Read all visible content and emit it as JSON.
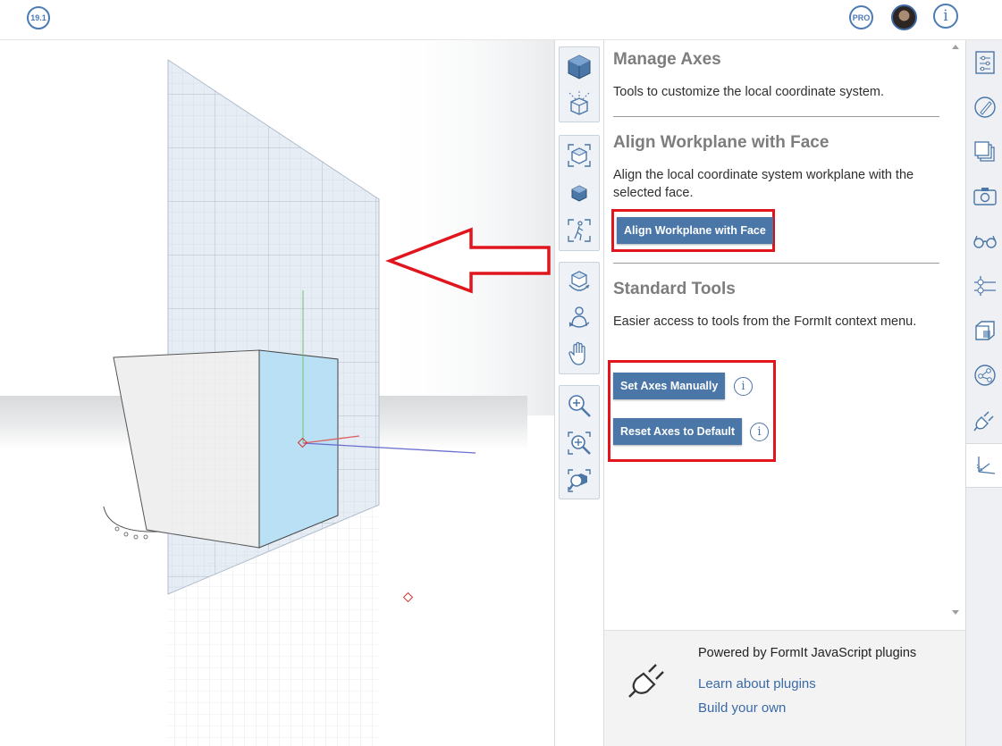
{
  "topbar": {
    "version_badge": "19.1",
    "pro_badge": "PRO",
    "info_glyph": "i"
  },
  "panel": {
    "sections": [
      {
        "title": "Manage Axes",
        "description": "Tools to customize the local coordinate system."
      },
      {
        "title": "Align Workplane with Face",
        "description": "Align the local coordinate system workplane with the selected face.",
        "button": "Align Workplane with Face"
      },
      {
        "title": "Standard Tools",
        "description": "Easier access to tools from the FormIt context menu.",
        "buttons": [
          "Set Axes Manually",
          "Reset Axes to Default"
        ]
      }
    ],
    "info_glyph": "i"
  },
  "footer": {
    "powered_by": "Powered by FormIt JavaScript plugins",
    "learn_link": "Learn about plugins",
    "build_link": "Build your own"
  },
  "colors": {
    "accent": "#4a76a8",
    "highlight_red": "#e0151e",
    "selected_face": "#b9e0f5"
  },
  "icons": {
    "toolstrip": [
      "view-cube-icon",
      "axes-view-icon",
      "perspective-view-icon",
      "shaded-view-icon",
      "walk-view-icon",
      "orbit-icon",
      "look-around-icon",
      "pan-hand-icon",
      "zoom-icon",
      "zoom-region-icon",
      "zoom-fit-icon"
    ],
    "sidebar": [
      "properties-icon",
      "materials-icon",
      "layers-icon",
      "scenes-icon",
      "visual-style-icon",
      "levels-icon",
      "groups-icon",
      "share-icon",
      "plugin-manager-icon",
      "manage-axes-icon"
    ]
  }
}
